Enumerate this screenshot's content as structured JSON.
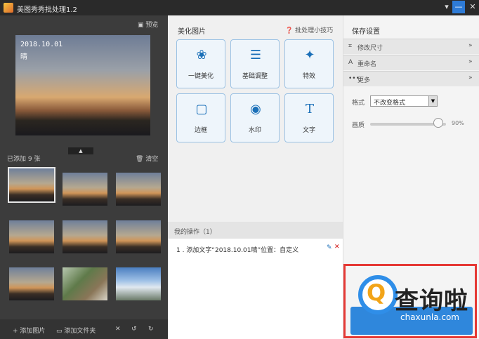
{
  "window": {
    "title": "美图秀秀批处理1.2",
    "menu_icon": "menu-icon",
    "min_icon": "minimize-icon",
    "close_icon": "close-icon"
  },
  "left": {
    "preview_label": "预览",
    "preview_overlay": {
      "date": "2018.10.01",
      "text": "晴"
    },
    "added_label": "已添加 9 张",
    "clear_label": "清空",
    "thumbnails": [
      "sunset",
      "sunset",
      "sunset",
      "sunset",
      "sunset",
      "sunset",
      "sunset",
      "plants",
      "sky"
    ],
    "bottom": {
      "add_image": "添加图片",
      "add_folder": "添加文件夹"
    }
  },
  "middle": {
    "title": "美化图片",
    "tips": "批处理小技巧",
    "tools": [
      {
        "label": "一键美化",
        "icon": "flower-icon"
      },
      {
        "label": "基础调整",
        "icon": "sliders-icon"
      },
      {
        "label": "特效",
        "icon": "magic-wand-icon"
      },
      {
        "label": "边框",
        "icon": "frame-icon"
      },
      {
        "label": "水印",
        "icon": "watermark-icon"
      },
      {
        "label": "文字",
        "icon": "text-icon"
      }
    ],
    "ops_title": "我的操作（1）",
    "ops": [
      {
        "text": "1 . 添加文字“2018.10.01晴”位置：自定义"
      }
    ]
  },
  "right": {
    "title": "保存设置",
    "sections": [
      {
        "label": "修改尺寸",
        "icon": "crop-icon",
        "chevron": "»"
      },
      {
        "label": "重命名",
        "icon": "rename-icon",
        "chevron": "»"
      },
      {
        "label": "更多",
        "icon": "more-icon",
        "chevron": "»"
      }
    ],
    "format_label": "格式",
    "format_value": "不改变格式",
    "quality_label": "画质",
    "quality_value": "90%"
  },
  "watermark": {
    "text": "查询啦",
    "url": "chaxunla.com"
  },
  "colors": {
    "accent": "#2f87dc",
    "highlight": "#e53935",
    "watermark_q": "#f2a418"
  }
}
